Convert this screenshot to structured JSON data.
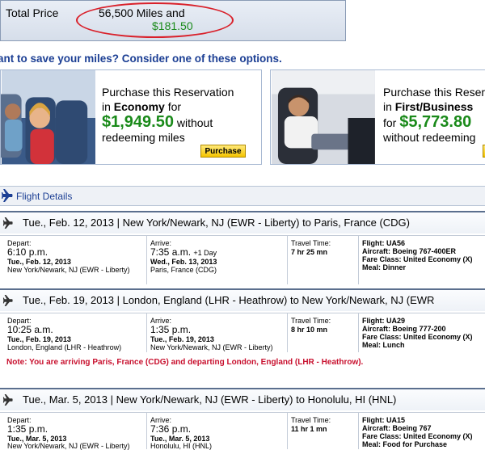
{
  "total": {
    "label": "Total Price",
    "miles": "56,500 Miles and",
    "cash": "$181.50"
  },
  "save_prompt": "ant to save your miles? Consider one of these options.",
  "promos": {
    "economy": {
      "line1": "Purchase this Reservation",
      "line2_prefix": "in ",
      "cabin": "Economy",
      "line2_suffix": " for",
      "price": "$1,949.50",
      "price_suffix": " without",
      "line4": "redeeming miles",
      "button": "Purchase"
    },
    "first": {
      "line1": "Purchase this Reser",
      "line2_prefix": "in ",
      "cabin": "First/Business",
      "line3_prefix": "for ",
      "price": "$5,773.80",
      "line4": "without redeeming"
    }
  },
  "flight_details": {
    "title": "Flight Details"
  },
  "segments": [
    {
      "route": "Tue., Feb. 12, 2013 | New York/Newark, NJ (EWR - Liberty) to Paris, France (CDG)",
      "depart_label": "Depart:",
      "depart_time": "6:10 p.m.",
      "depart_date": "Tue., Feb. 12, 2013",
      "depart_place": "New York/Newark, NJ (EWR - Liberty)",
      "arrive_label": "Arrive:",
      "arrive_time": "7:35 a.m.",
      "arrive_extra": "+1 Day",
      "arrive_date": "Wed., Feb. 13, 2013",
      "arrive_place": "Paris, France (CDG)",
      "travel_label": "Travel Time:",
      "travel_time": "7 hr 25 mn",
      "flight": "Flight: UA56",
      "aircraft": "Aircraft: Boeing 767-400ER",
      "fare": "Fare Class: United Economy (X)",
      "meal": "Meal: Dinner"
    },
    {
      "route": "Tue., Feb. 19, 2013 | London, England (LHR - Heathrow) to New York/Newark, NJ (EWR",
      "depart_label": "Depart:",
      "depart_time": "10:25 a.m.",
      "depart_date": "Tue., Feb. 19, 2013",
      "depart_place": "London, England (LHR - Heathrow)",
      "arrive_label": "Arrive:",
      "arrive_time": "1:35 p.m.",
      "arrive_extra": "",
      "arrive_date": "Tue., Feb. 19, 2013",
      "arrive_place": "New York/Newark, NJ (EWR - Liberty)",
      "travel_label": "Travel Time:",
      "travel_time": "8 hr 10 mn",
      "flight": "Flight: UA29",
      "aircraft": "Aircraft: Boeing 777-200",
      "fare": "Fare Class: United Economy (X)",
      "meal": "Meal: Lunch",
      "note": "Note: You are arriving Paris, France (CDG) and departing London, England (LHR - Heathrow)."
    },
    {
      "route": "Tue., Mar. 5, 2013 | New York/Newark, NJ (EWR - Liberty) to Honolulu, HI (HNL)",
      "depart_label": "Depart:",
      "depart_time": "1:35 p.m.",
      "depart_date": "Tue., Mar. 5, 2013",
      "depart_place": "New York/Newark, NJ (EWR - Liberty)",
      "arrive_label": "Arrive:",
      "arrive_time": "7:36 p.m.",
      "arrive_extra": "",
      "arrive_date": "Tue., Mar. 5, 2013",
      "arrive_place": "Honolulu, HI (HNL)",
      "travel_label": "Travel Time:",
      "travel_time": "11 hr 1 mn",
      "flight": "Flight: UA15",
      "aircraft": "Aircraft: Boeing 767",
      "fare": "Fare Class: United Economy (X)",
      "meal": "Meal: Food for Purchase"
    }
  ],
  "colors": {
    "accent": "#1c3f94",
    "price_green": "#1a8a1a",
    "note_red": "#c8102e",
    "highlight_circle": "#d9202a"
  }
}
